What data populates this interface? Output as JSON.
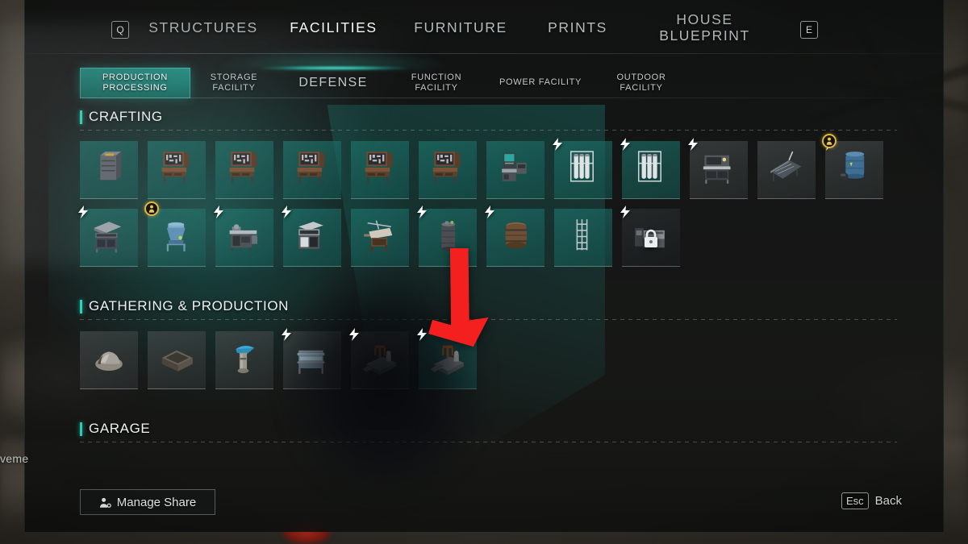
{
  "header": {
    "left_key": "Q",
    "right_key": "E",
    "tabs": [
      {
        "label": "STRUCTURES",
        "active": false
      },
      {
        "label": "FACILITIES",
        "active": true
      },
      {
        "label": "FURNITURE",
        "active": false
      },
      {
        "label": "PRINTS",
        "active": false
      },
      {
        "label": "HOUSE\nBLUEPRINT",
        "active": false
      }
    ]
  },
  "subtabs": [
    {
      "label": "PRODUCTION\nPROCESSING",
      "active": true,
      "wide": false
    },
    {
      "label": "STORAGE\nFACILITY",
      "active": false,
      "wide": false
    },
    {
      "label": "DEFENSE",
      "active": false,
      "wide": true
    },
    {
      "label": "FUNCTION\nFACILITY",
      "active": false,
      "wide": false
    },
    {
      "label": "POWER FACILITY",
      "active": false,
      "wide": false
    },
    {
      "label": "OUTDOOR\nFACILITY",
      "active": false,
      "wide": false
    }
  ],
  "sections": [
    {
      "title": "CRAFTING",
      "rows": [
        [
          {
            "art": "cabinet",
            "bg": "teal",
            "power": false,
            "gold": false,
            "locked": false
          },
          {
            "art": "workbench",
            "bg": "teal",
            "power": false,
            "gold": false,
            "locked": false
          },
          {
            "art": "workbench",
            "bg": "teal",
            "power": false,
            "gold": false,
            "locked": false
          },
          {
            "art": "workbench",
            "bg": "teal",
            "power": false,
            "gold": false,
            "locked": false
          },
          {
            "art": "workbench",
            "bg": "teal",
            "power": false,
            "gold": false,
            "locked": false
          },
          {
            "art": "workbench",
            "bg": "teal",
            "power": false,
            "gold": false,
            "locked": false
          },
          {
            "art": "lab-bench",
            "bg": "teal",
            "power": false,
            "gold": false,
            "locked": false
          },
          {
            "art": "tank-rack",
            "bg": "teal",
            "power": true,
            "gold": false,
            "locked": false
          },
          {
            "art": "tank-rack",
            "bg": "teal",
            "power": true,
            "gold": false,
            "locked": false
          },
          {
            "art": "fume-hood",
            "bg": "dark",
            "power": true,
            "gold": false,
            "locked": false
          },
          {
            "art": "drafting",
            "bg": "dark",
            "power": false,
            "gold": false,
            "locked": false
          },
          {
            "art": "blue-tank",
            "bg": "dark",
            "power": true,
            "gold": true,
            "locked": false
          }
        ],
        [
          {
            "art": "grill",
            "bg": "teal",
            "power": true,
            "gold": false,
            "locked": false
          },
          {
            "art": "blue-hopper",
            "bg": "teal",
            "power": false,
            "gold": true,
            "locked": false
          },
          {
            "art": "stove",
            "bg": "teal",
            "power": true,
            "gold": false,
            "locked": false
          },
          {
            "art": "oven",
            "bg": "teal",
            "power": true,
            "gold": false,
            "locked": false
          },
          {
            "art": "loom",
            "bg": "teal",
            "power": false,
            "gold": false,
            "locked": false
          },
          {
            "art": "boiler",
            "bg": "teal",
            "power": true,
            "gold": false,
            "locked": false
          },
          {
            "art": "barrel",
            "bg": "teal",
            "power": true,
            "gold": false,
            "locked": false
          },
          {
            "art": "scaffold",
            "bg": "teal",
            "power": false,
            "gold": false,
            "locked": false
          },
          {
            "art": "machine",
            "bg": "locked",
            "power": true,
            "gold": false,
            "locked": true
          }
        ]
      ]
    },
    {
      "title": "GATHERING & PRODUCTION",
      "rows": [
        [
          {
            "art": "ore-pile",
            "bg": "dark",
            "power": false,
            "gold": false,
            "locked": false
          },
          {
            "art": "planter",
            "bg": "dark",
            "power": false,
            "gold": false,
            "locked": false
          },
          {
            "art": "water-pump",
            "bg": "dark",
            "power": false,
            "gold": false,
            "locked": false
          },
          {
            "art": "hydro-table",
            "bg": "dark",
            "power": true,
            "gold": false,
            "locked": false
          },
          {
            "art": "rig-platform",
            "bg": "dark",
            "power": true,
            "gold": false,
            "locked": false
          },
          {
            "art": "rig-platform",
            "bg": "teal",
            "power": true,
            "gold": false,
            "locked": false
          }
        ]
      ]
    },
    {
      "title": "GARAGE",
      "rows": []
    }
  ],
  "footer": {
    "manage_share_label": "Manage Share",
    "back_key": "Esc",
    "back_label": "Back"
  },
  "edge_text": "veme",
  "colors": {
    "accent_teal": "#2ad4bc",
    "tab_highlight": "#24b4a5",
    "gold_badge": "#e0b63c",
    "arrow_red": "#f42020"
  }
}
